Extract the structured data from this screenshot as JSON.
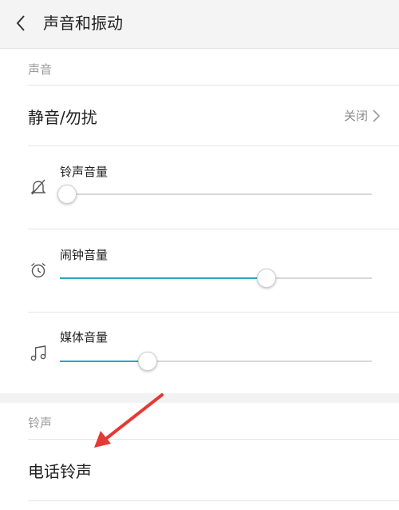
{
  "header": {
    "title": "声音和振动",
    "back_icon": "chevron-left-icon"
  },
  "sections": {
    "sound_header": "声音",
    "ringtone_header": "铃声"
  },
  "mute": {
    "label": "静音/勿扰",
    "value": "关闭",
    "icon": "chevron-right-icon"
  },
  "sliders": [
    {
      "label": "铃声音量",
      "icon": "bell-off-icon",
      "level": 0.02
    },
    {
      "label": "闹钟音量",
      "icon": "alarm-clock-icon",
      "level": 0.66
    },
    {
      "label": "媒体音量",
      "icon": "music-note-icon",
      "level": 0.28
    }
  ],
  "phone_ringtone": {
    "label": "电话铃声"
  },
  "colors": {
    "accent": "#2aa6c4",
    "annotation_arrow": "#e53935"
  }
}
